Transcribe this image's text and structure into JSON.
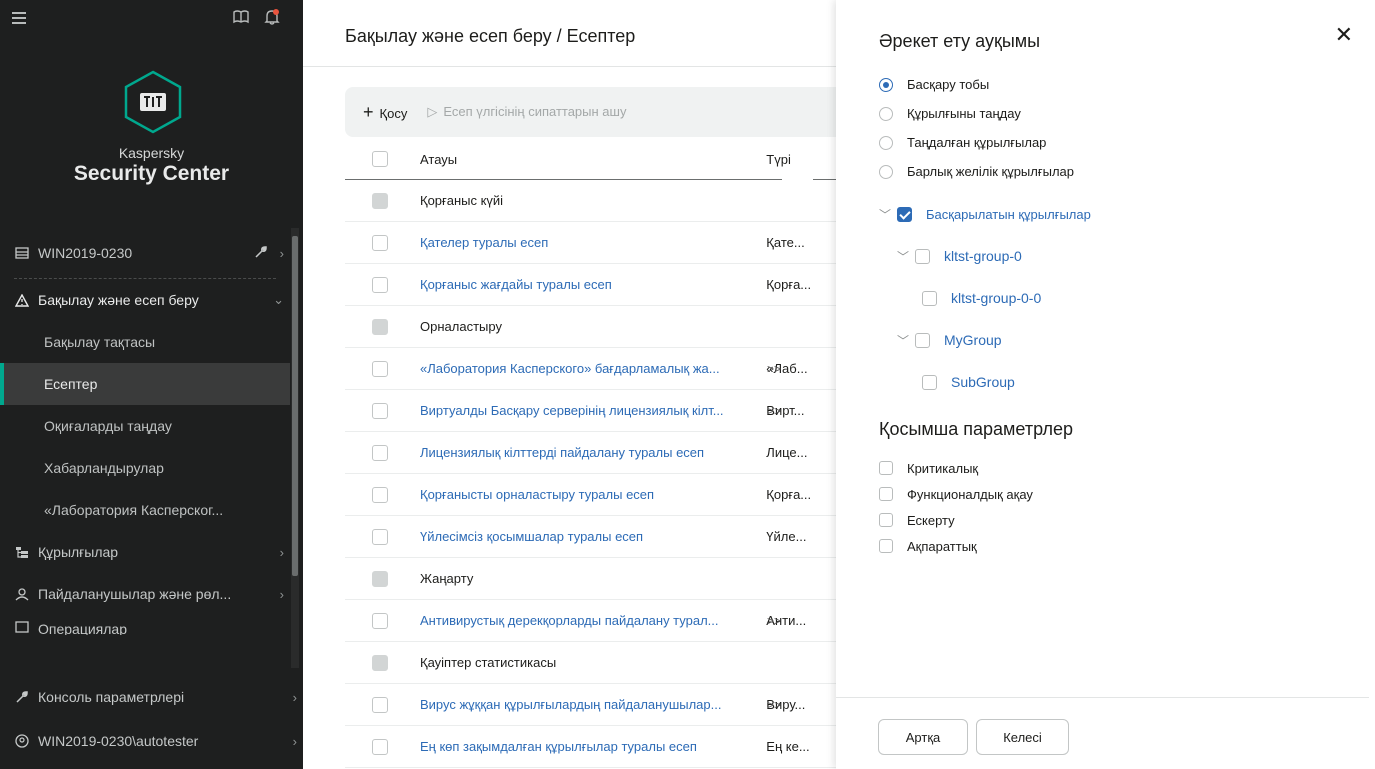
{
  "sidebar": {
    "brand_top": "Kaspersky",
    "brand_bottom": "Security Center",
    "server": "WIN2019-0230",
    "section": "Бақылау және есеп беру",
    "sub_items": [
      "Бақылау тақтасы",
      "Есептер",
      "Оқиғаларды таңдау",
      "Хабарландырулар",
      "«Лаборатория Касперског..."
    ],
    "devices": "Құрылғылар",
    "users": "Пайдаланушылар және рөл...",
    "operations": "Операциялар",
    "console": "Консоль параметрлері",
    "account": "WIN2019-0230\\autotester"
  },
  "main": {
    "breadcrumb": "Бақылау және есеп беру  /  Есептер",
    "add_label": "Қосу",
    "open_label": "Есеп үлгісінің сипаттарын ашу",
    "col_name": "Атауы",
    "col_type": "Түрі",
    "rows": [
      {
        "name": "Қорғаныс күйі",
        "type": "",
        "group": true
      },
      {
        "name": "Қателер туралы есеп",
        "type": "Қате..."
      },
      {
        "name": "Қорғаныс жағдайы туралы есеп",
        "type": "Қорға..."
      },
      {
        "name": "Орналастыру",
        "type": "",
        "group": true
      },
      {
        "name": "«Лаборатория Касперского» бағдарламалық жа...",
        "type": "«Лаб...",
        "more": ">>"
      },
      {
        "name": "Виртуалды Басқару серверінің лицензиялық кілт...",
        "type": "Вирт...",
        "more": ">>"
      },
      {
        "name": "Лицензиялық кілттерді пайдалану туралы есеп",
        "type": "Лице..."
      },
      {
        "name": "Қорғанысты орналастыру туралы есеп",
        "type": "Қорға..."
      },
      {
        "name": "Үйлесімсіз қосымшалар туралы есеп",
        "type": "Үйле..."
      },
      {
        "name": "Жаңарту",
        "type": "",
        "group": true
      },
      {
        "name": "Антивирустық дерекқорларды пайдалану турал...",
        "type": "Анти...",
        "more": ">>"
      },
      {
        "name": "Қауіптер статистикасы",
        "type": "",
        "group": true
      },
      {
        "name": "Вирус жұққан құрылғылардың пайдаланушылар...",
        "type": "Виру...",
        "more": ">>"
      },
      {
        "name": "Ең көп зақымдалған құрылғылар туралы есеп",
        "type": "Ең ке..."
      }
    ]
  },
  "panel": {
    "title": "Әрекет ету ауқымы",
    "radios": [
      "Басқару тобы",
      "Құрылғыны таңдау",
      "Таңдалған құрылғылар",
      "Барлық желілік құрылғылар"
    ],
    "tree": {
      "root": "Басқарылатын құрылғылар",
      "g0": "kltst-group-0",
      "g00": "kltst-group-0-0",
      "g1": "MyGroup",
      "g11": "SubGroup"
    },
    "extra_title": "Қосымша параметрлер",
    "checks": [
      "Критикалық",
      "Функционалдық ақау",
      "Ескерту",
      "Ақпараттық"
    ],
    "back": "Артқа",
    "next": "Келесі"
  },
  "colors": {
    "sidebar_bg": "#1e1f1f",
    "accent": "#00a88e",
    "link": "#2d6bb6",
    "bell_dot": "#e8543e"
  }
}
